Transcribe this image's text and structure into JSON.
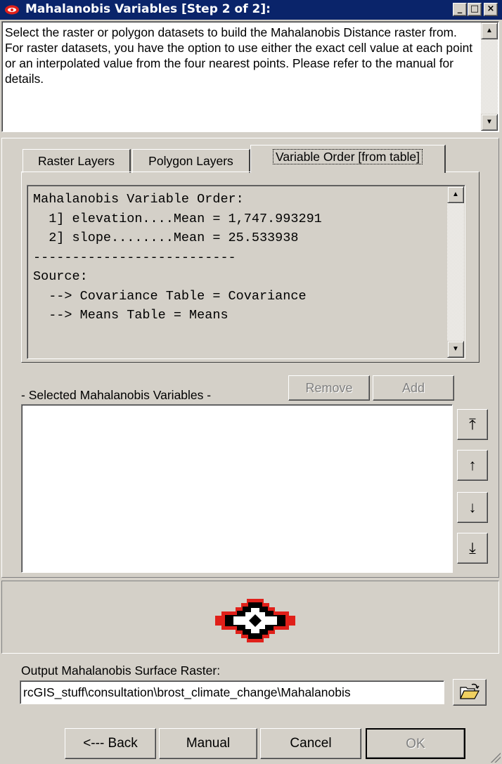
{
  "window": {
    "title": "Mahalanobis Variables [Step 2 of 2]:",
    "minimize": "_",
    "maximize": "□",
    "close": "×"
  },
  "description": "Select the raster or polygon datasets to build the Mahalanobis Distance raster from. For raster datasets, you have the option to use either the exact cell value at each point or an interpolated value from the four nearest points.  Please refer to the manual for details.",
  "tabs": [
    {
      "label": "Raster Layers"
    },
    {
      "label": "Polygon Layers"
    },
    {
      "label": "Variable Order [from table]"
    }
  ],
  "variable_order": {
    "lines": [
      "Mahalanobis Variable Order:",
      "  1] elevation....Mean = 1,747.993291",
      "  2] slope........Mean = 25.533938",
      "--------------------------",
      "Source:",
      "  --> Covariance Table = Covariance",
      "  --> Means Table = Means"
    ]
  },
  "selected": {
    "label": "- Selected Mahalanobis Variables -",
    "remove": "Remove",
    "add": "Add"
  },
  "order_buttons": {
    "top": "⤒",
    "up": "↑",
    "down": "↓",
    "bottom": "⤓"
  },
  "output": {
    "label": "Output Mahalanobis Surface Raster:",
    "value": "rcGIS_stuff\\consultation\\brost_climate_change\\Mahalanobis",
    "browse_icon": "folder-open-icon"
  },
  "footer": {
    "back": "<--- Back",
    "manual": "Manual",
    "cancel": "Cancel",
    "ok": "OK"
  },
  "colors": {
    "titlebar": "#0a246a",
    "face": "#d4d0c8",
    "logo_red": "#e0201a"
  }
}
